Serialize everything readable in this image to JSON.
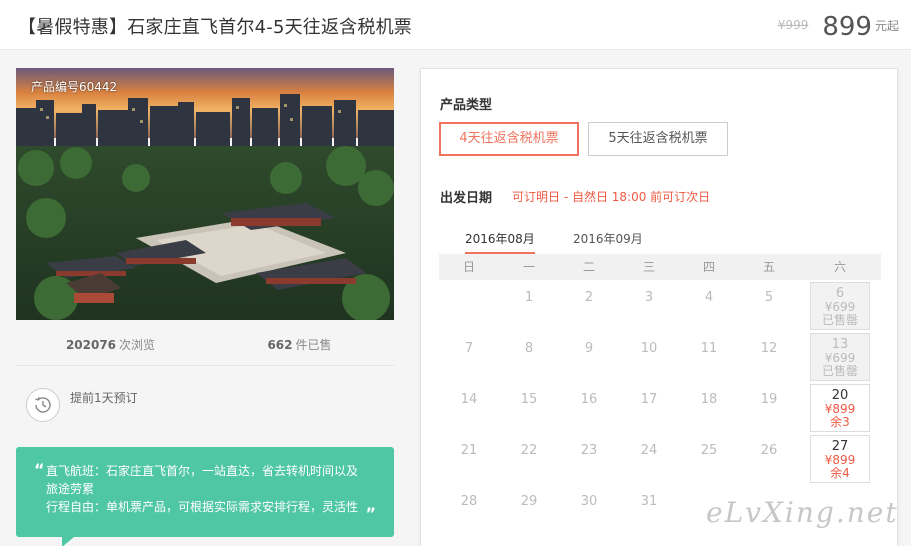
{
  "header": {
    "title": "【暑假特惠】石家庄直飞首尔4-5天往返含税机票",
    "price_original": "¥999",
    "price_now": "899",
    "price_unit": "元起"
  },
  "photo": {
    "product_no": "产品编号60442"
  },
  "stats": {
    "views_count": "202076",
    "views_label": "次浏览",
    "sold_count": "662",
    "sold_label": "件已售"
  },
  "booking": {
    "advance_text": "提前1天预订"
  },
  "feature": {
    "line1": "直飞航班：石家庄直飞首尔，一站直达，省去转机时间以及旅途劳累",
    "line2": "行程自由：单机票产品，可根据实际需求安排行程，灵活性"
  },
  "panel": {
    "type_label": "产品类型",
    "types": [
      "4天往返含税机票",
      "5天往返含税机票"
    ],
    "date_label": "出发日期",
    "date_note": "可订明日 - 自然日 18:00 前可订次日",
    "months": [
      "2016年08月",
      "2016年09月"
    ],
    "weekdays": [
      "日",
      "一",
      "二",
      "三",
      "四",
      "五",
      "六"
    ],
    "weeks": [
      [
        "",
        "1",
        "2",
        "3",
        "4",
        "5"
      ],
      [
        "7",
        "8",
        "9",
        "10",
        "11",
        "12"
      ],
      [
        "14",
        "15",
        "16",
        "17",
        "18",
        "19"
      ],
      [
        "21",
        "22",
        "23",
        "24",
        "25",
        "26"
      ],
      [
        "28",
        "29",
        "30",
        "31",
        "",
        ""
      ]
    ],
    "saturdays": [
      {
        "day": "6",
        "price": "¥699",
        "status": "已售罄"
      },
      {
        "day": "13",
        "price": "¥699",
        "status": "已售罄"
      },
      {
        "day": "20",
        "price": "¥899",
        "status": "余3"
      },
      {
        "day": "27",
        "price": "¥899",
        "status": "余4"
      }
    ]
  },
  "watermark": "eLvXing.net",
  "colors": {
    "accent": "#f0735d",
    "green": "#4fc6a4",
    "red_text": "#ee5a43"
  }
}
